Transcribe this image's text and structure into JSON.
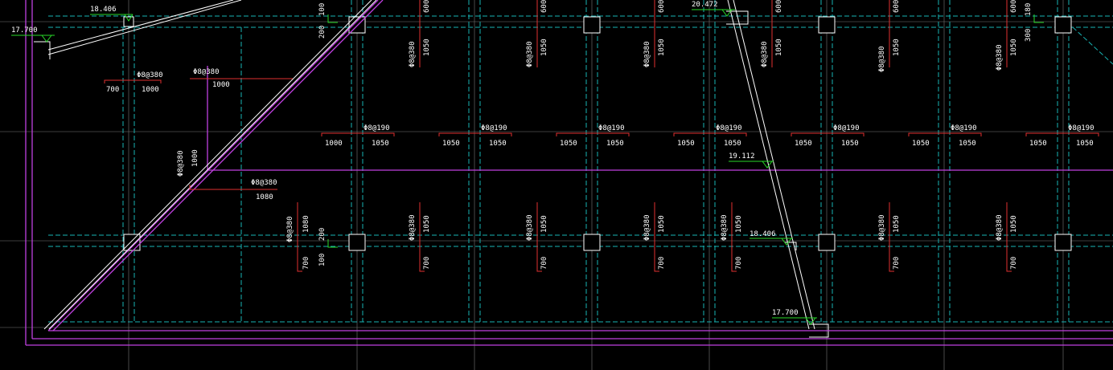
{
  "drawing": {
    "colors": {
      "background": "#000000",
      "grid_axis": "#d8d8d8",
      "beam_dashed": "#18b4b4",
      "slab_edge": "#c040e0",
      "dimension": "#e03030",
      "elevation_marker": "#28d828",
      "text": "#ffffff",
      "outline": "#ffffff"
    },
    "elevations": [
      "18.406",
      "17.700",
      "20.472",
      "19.112",
      "18.406",
      "17.700"
    ],
    "rebar_labels": {
      "r380_a": "Φ8@380",
      "r380_b": "Φ8@380",
      "r380_c": "Φ8@380",
      "r380_d": "Φ8@380",
      "top_row": [
        "Φ8@380",
        "Φ8@380",
        "Φ8@380",
        "Φ8@380",
        "Φ8@380",
        "Φ8@380"
      ],
      "mid_row": [
        "Φ8@190",
        "Φ8@190",
        "Φ8@190",
        "Φ8@190",
        "Φ8@190",
        "Φ8@190",
        "Φ8@190"
      ],
      "bot_row": [
        "Φ8@380",
        "Φ8@380",
        "Φ8@380",
        "Φ8@380",
        "Φ8@380",
        "Φ8@380",
        "Φ8@380",
        "Φ8@380"
      ]
    },
    "dims": {
      "d700": "700",
      "d1000": "1000",
      "d1000b": "1000",
      "d1000c": "1000",
      "d1080": "1080",
      "v100": "100",
      "v200": "200",
      "v180": "180",
      "v300": "300",
      "top_600": [
        "600",
        "600",
        "600",
        "600",
        "600",
        "600"
      ],
      "top_1050": [
        "1050",
        "1050",
        "1050",
        "1050",
        "1050",
        "1050"
      ],
      "mid_pairs": [
        [
          "1000",
          "1050"
        ],
        [
          "1050",
          "1050"
        ],
        [
          "1050",
          "1050"
        ],
        [
          "1050",
          "1050"
        ],
        [
          "1050",
          "1050"
        ],
        [
          "1050",
          "1050"
        ],
        [
          "1050",
          "1050"
        ]
      ],
      "bot_1050": [
        "1080",
        "1050",
        "1050",
        "1050",
        "1050",
        "1050",
        "1050",
        "1050"
      ],
      "bot_700": [
        "700",
        "700",
        "700",
        "700",
        "700",
        "700",
        "700",
        "700"
      ],
      "bot_100": "100",
      "bot_200": "200"
    }
  }
}
